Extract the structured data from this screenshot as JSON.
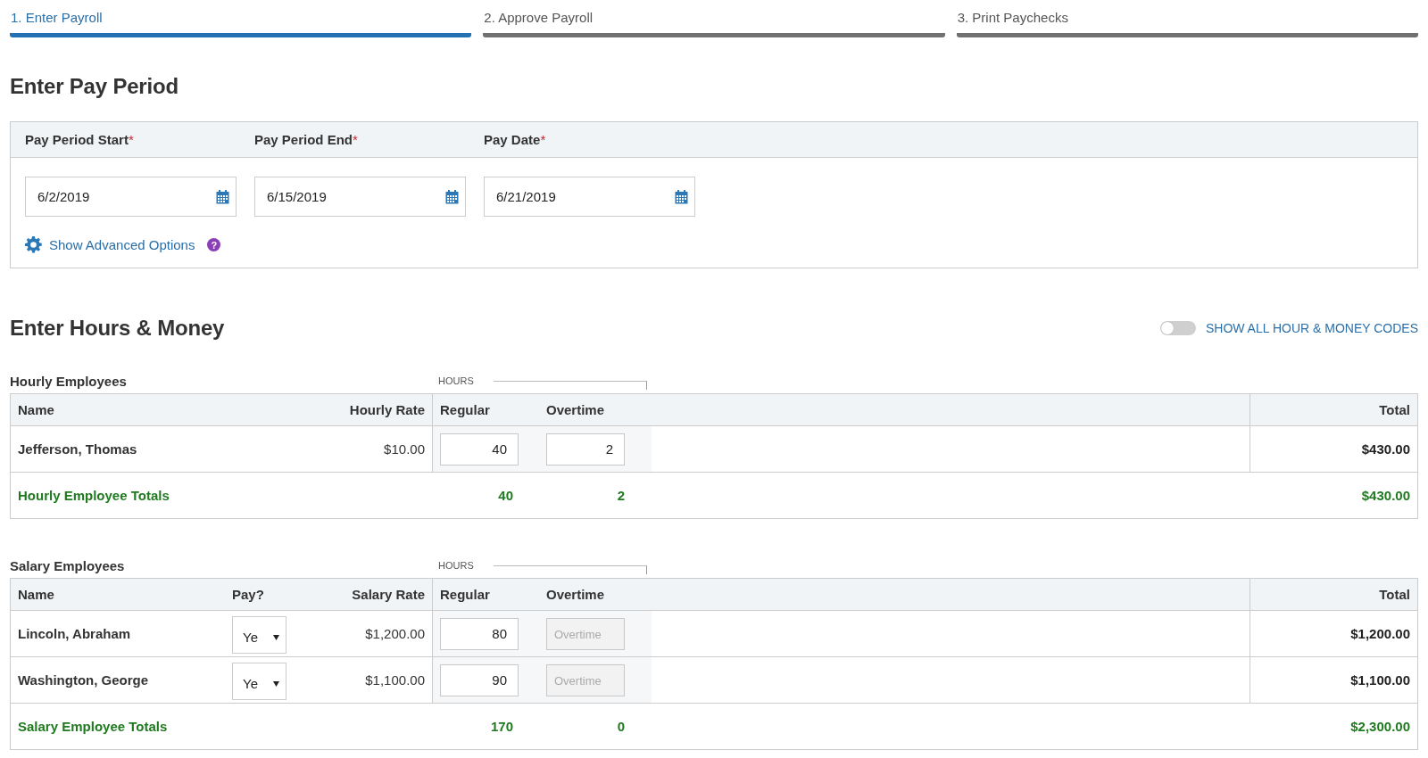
{
  "steps": [
    {
      "label": "1. Enter Payroll",
      "selected": true
    },
    {
      "label": "2. Approve Payroll",
      "selected": false
    },
    {
      "label": "3. Print Paychecks",
      "selected": false
    }
  ],
  "pay_period": {
    "heading": "Enter Pay Period",
    "fields": [
      {
        "label": "Pay Period Start",
        "required_mark": "*",
        "value": "6/2/2019"
      },
      {
        "label": "Pay Period End",
        "required_mark": "*",
        "value": "6/15/2019"
      },
      {
        "label": "Pay Date",
        "required_mark": "*",
        "value": "6/21/2019"
      }
    ],
    "advanced_link": "Show Advanced Options",
    "help": "?"
  },
  "hours_money": {
    "heading": "Enter Hours & Money",
    "toggle": {
      "label": "SHOW ALL HOUR & MONEY CODES",
      "on": false
    },
    "tables": [
      {
        "title": "Hourly Employees",
        "group_label": "HOURS",
        "columns": [
          {
            "kind": "name",
            "label": "Name"
          },
          {
            "kind": "rate",
            "label": "Hourly Rate"
          },
          {
            "kind": "regular",
            "label": "Regular"
          },
          {
            "kind": "overtime",
            "label": "Overtime"
          },
          {
            "kind": "total",
            "label": "Total"
          }
        ],
        "rows": [
          {
            "name": "Jefferson, Thomas",
            "rate": "$10.00",
            "regular": "40",
            "overtime": {
              "value": "2",
              "disabled": false
            },
            "total": "$430.00"
          }
        ],
        "totals": {
          "label": "Hourly Employee Totals",
          "regular": "40",
          "overtime": "2",
          "total": "$430.00"
        }
      },
      {
        "title": "Salary Employees",
        "group_label": "HOURS",
        "columns": [
          {
            "kind": "name",
            "label": "Name"
          },
          {
            "kind": "pay",
            "label": "Pay?"
          },
          {
            "kind": "rate",
            "label": "Salary Rate"
          },
          {
            "kind": "regular",
            "label": "Regular"
          },
          {
            "kind": "overtime",
            "label": "Overtime"
          },
          {
            "kind": "total",
            "label": "Total"
          }
        ],
        "rows": [
          {
            "name": "Lincoln, Abraham",
            "pay": "Ye",
            "rate": "$1,200.00",
            "regular": "80",
            "overtime": {
              "placeholder": "Overtime",
              "disabled": true
            },
            "total": "$1,200.00"
          },
          {
            "name": "Washington, George",
            "pay": "Ye",
            "rate": "$1,100.00",
            "regular": "90",
            "overtime": {
              "placeholder": "Overtime",
              "disabled": true
            },
            "total": "$1,100.00"
          }
        ],
        "totals": {
          "label": "Salary Employee Totals",
          "regular": "170",
          "overtime": "0",
          "total": "$2,300.00"
        }
      }
    ]
  }
}
